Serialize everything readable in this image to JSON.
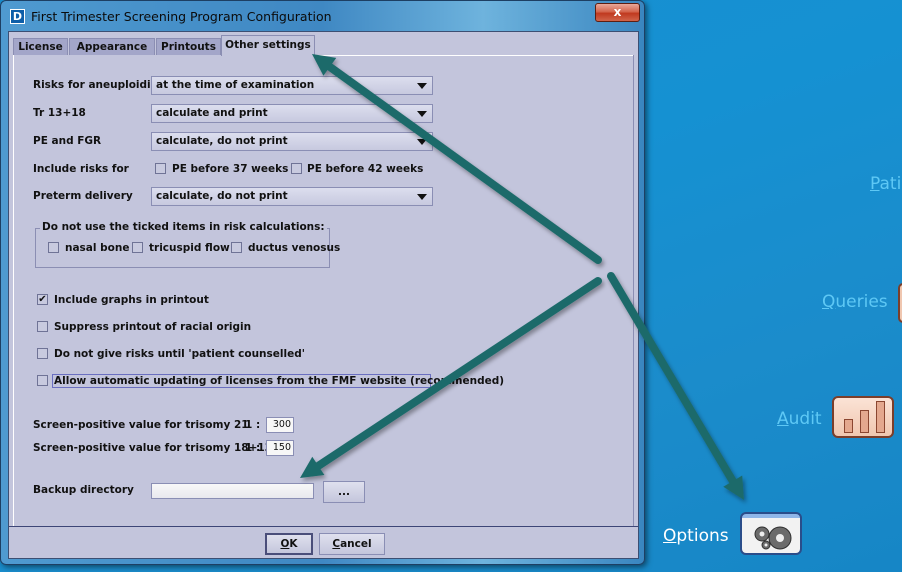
{
  "background_app": {
    "links": [
      {
        "label": "Patients",
        "visible_text": "Pati",
        "accent_letter": "P"
      },
      {
        "label": "Queries",
        "accent_letter": "Q"
      },
      {
        "label": "Audit",
        "accent_letter": "A"
      },
      {
        "label": "Options",
        "accent_letter": "O"
      }
    ],
    "icons": [
      "queries-icon",
      "audit-chart-icon",
      "options-gears-icon"
    ]
  },
  "dialog": {
    "title": "First Trimester Screening Program Configuration",
    "close_label": "x",
    "tabs": [
      {
        "label": "License",
        "active": false
      },
      {
        "label": "Appearance",
        "active": false
      },
      {
        "label": "Printouts",
        "active": false
      },
      {
        "label": "Other settings",
        "active": true
      }
    ],
    "fields": {
      "risks_aneuploidies": {
        "label": "Risks for aneuploidies",
        "value": "at the time of examination"
      },
      "tr_13_18": {
        "label": "Tr 13+18",
        "value": "calculate and print"
      },
      "pe_fgr": {
        "label": "PE and FGR",
        "value": "calculate, do not print"
      },
      "include_risks": {
        "label": "Include risks for",
        "options": [
          {
            "label": "PE before 37 weeks",
            "checked": false
          },
          {
            "label": "PE before 42 weeks",
            "checked": false
          }
        ]
      },
      "preterm_delivery": {
        "label": "Preterm delivery",
        "value": "calculate, do not print"
      }
    },
    "exclusion_group": {
      "title": "Do not use the ticked items in risk calculations:",
      "options": [
        {
          "label": "nasal bone",
          "checked": false
        },
        {
          "label": "tricuspid flow",
          "checked": false
        },
        {
          "label": "ductus venosus",
          "checked": false
        }
      ]
    },
    "checkboxes": [
      {
        "label": "Include graphs in printout",
        "checked": true,
        "mark": "✔"
      },
      {
        "label": "Suppress printout of racial origin",
        "checked": false
      },
      {
        "label": "Do not give risks until 'patient counselled'",
        "checked": false
      },
      {
        "label": "Allow automatic updating of licenses from the FMF website (recommended)",
        "checked": false,
        "focused": true
      }
    ],
    "screen_positive": [
      {
        "label": "Screen-positive value for trisomy 21",
        "ratio_prefix": "1 :",
        "value": "300"
      },
      {
        "label": "Screen-positive value for trisomy 18+13",
        "ratio_prefix": "1 :",
        "value": "150"
      }
    ],
    "backup": {
      "label": "Backup directory",
      "value": "",
      "browse_label": "..."
    },
    "buttons": {
      "ok": {
        "label": "OK",
        "accel": "O",
        "rest": "K"
      },
      "cancel": {
        "label": "Cancel",
        "accel": "C",
        "rest": "ancel"
      }
    }
  },
  "annotations": {
    "arrow_color": "#1e6b6b",
    "arrows": [
      {
        "points_to": "Other settings tab"
      },
      {
        "points_to": "Backup directory input"
      },
      {
        "points_to": "Options button"
      }
    ]
  }
}
